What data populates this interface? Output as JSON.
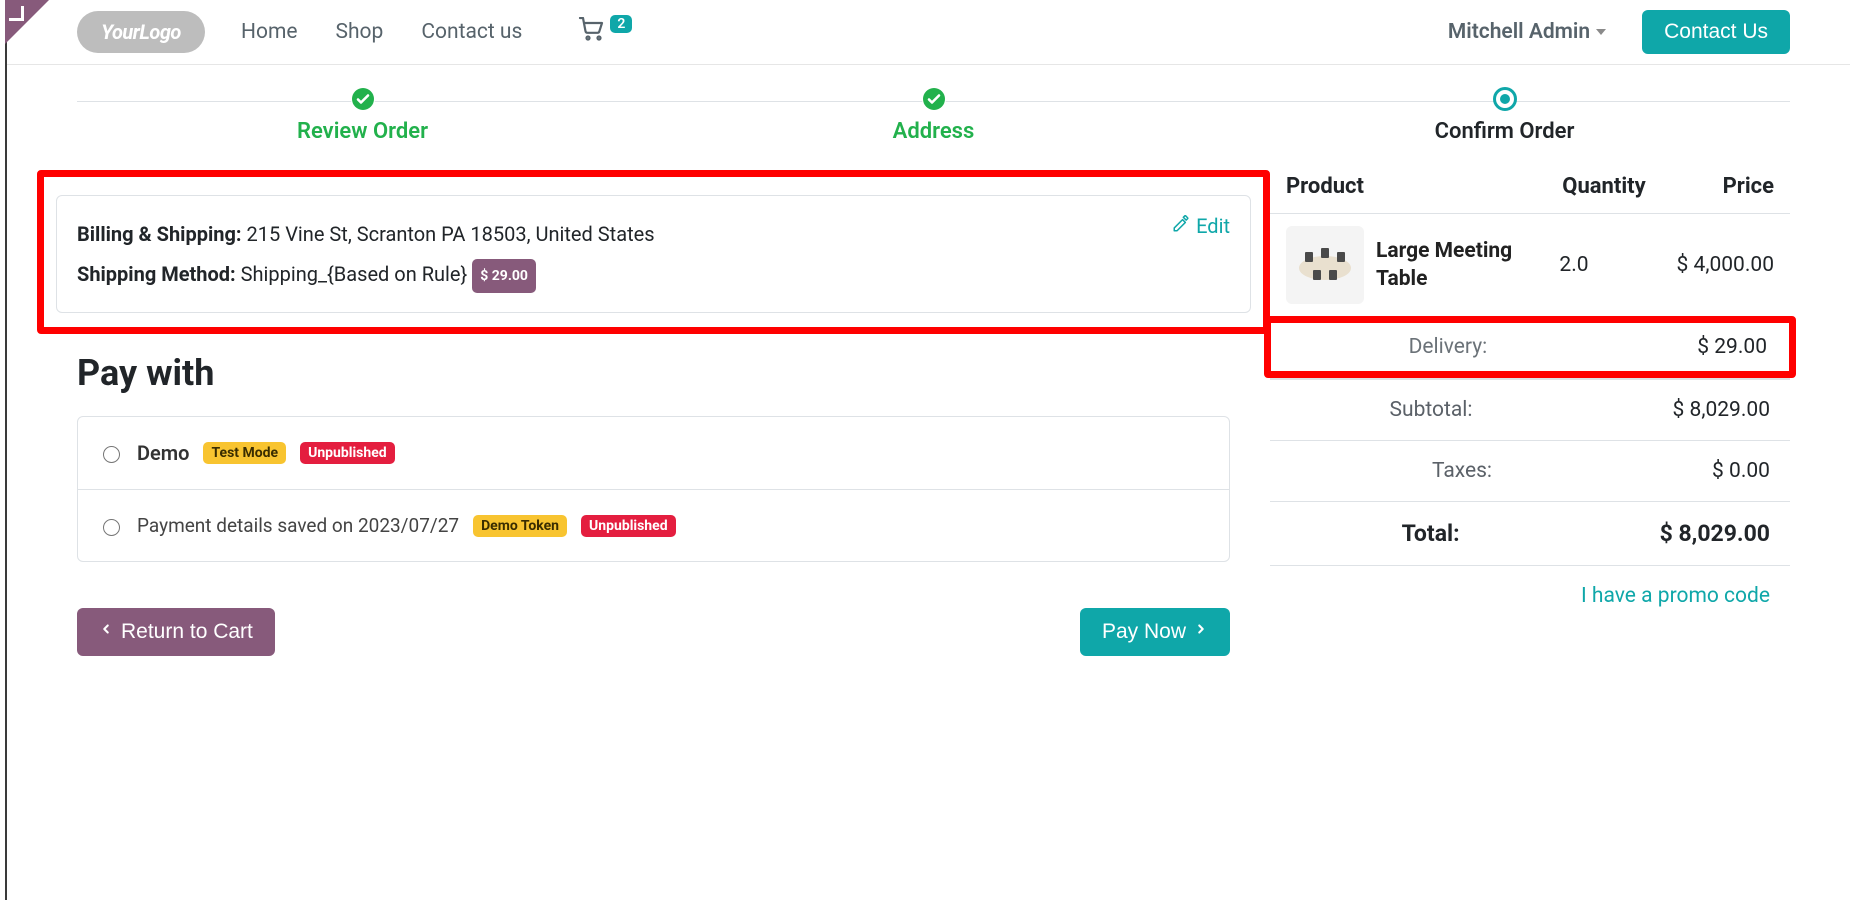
{
  "nav": {
    "logo_text_1": "Your",
    "logo_text_2": "Logo",
    "links": {
      "home": "Home",
      "shop": "Shop",
      "contact": "Contact us"
    },
    "cart_count": "2",
    "user": "Mitchell Admin",
    "contact_button": "Contact Us"
  },
  "steps": {
    "review": "Review Order",
    "address": "Address",
    "confirm": "Confirm Order"
  },
  "address_card": {
    "billing_label": "Billing & Shipping:",
    "billing_value": "215 Vine St, Scranton PA 18503, United States",
    "shipping_label": "Shipping Method:",
    "shipping_value": "Shipping_{Based on Rule}",
    "shipping_price_badge": "$ 29.00",
    "edit": "Edit"
  },
  "pay": {
    "heading": "Pay with",
    "options": [
      {
        "name": "Demo",
        "detail": "",
        "badges": [
          {
            "text": "Test Mode",
            "variant": "gold"
          },
          {
            "text": "Unpublished",
            "variant": "crimson"
          }
        ]
      },
      {
        "name": "",
        "detail": "Payment details saved on 2023/07/27",
        "badges": [
          {
            "text": "Demo Token",
            "variant": "gold"
          },
          {
            "text": "Unpublished",
            "variant": "crimson"
          }
        ]
      }
    ]
  },
  "buttons": {
    "return": "Return to Cart",
    "pay_now": "Pay Now"
  },
  "summary": {
    "headers": {
      "product": "Product",
      "quantity": "Quantity",
      "price": "Price"
    },
    "item": {
      "name": "Large Meeting Table",
      "qty": "2.0",
      "price": "$ 4,000.00"
    },
    "delivery": {
      "label": "Delivery:",
      "value": "$ 29.00"
    },
    "subtotal": {
      "label": "Subtotal:",
      "value": "$ 8,029.00"
    },
    "taxes": {
      "label": "Taxes:",
      "value": "$ 0.00"
    },
    "total": {
      "label": "Total:",
      "value": "$ 8,029.00"
    },
    "promo": "I have a promo code"
  }
}
